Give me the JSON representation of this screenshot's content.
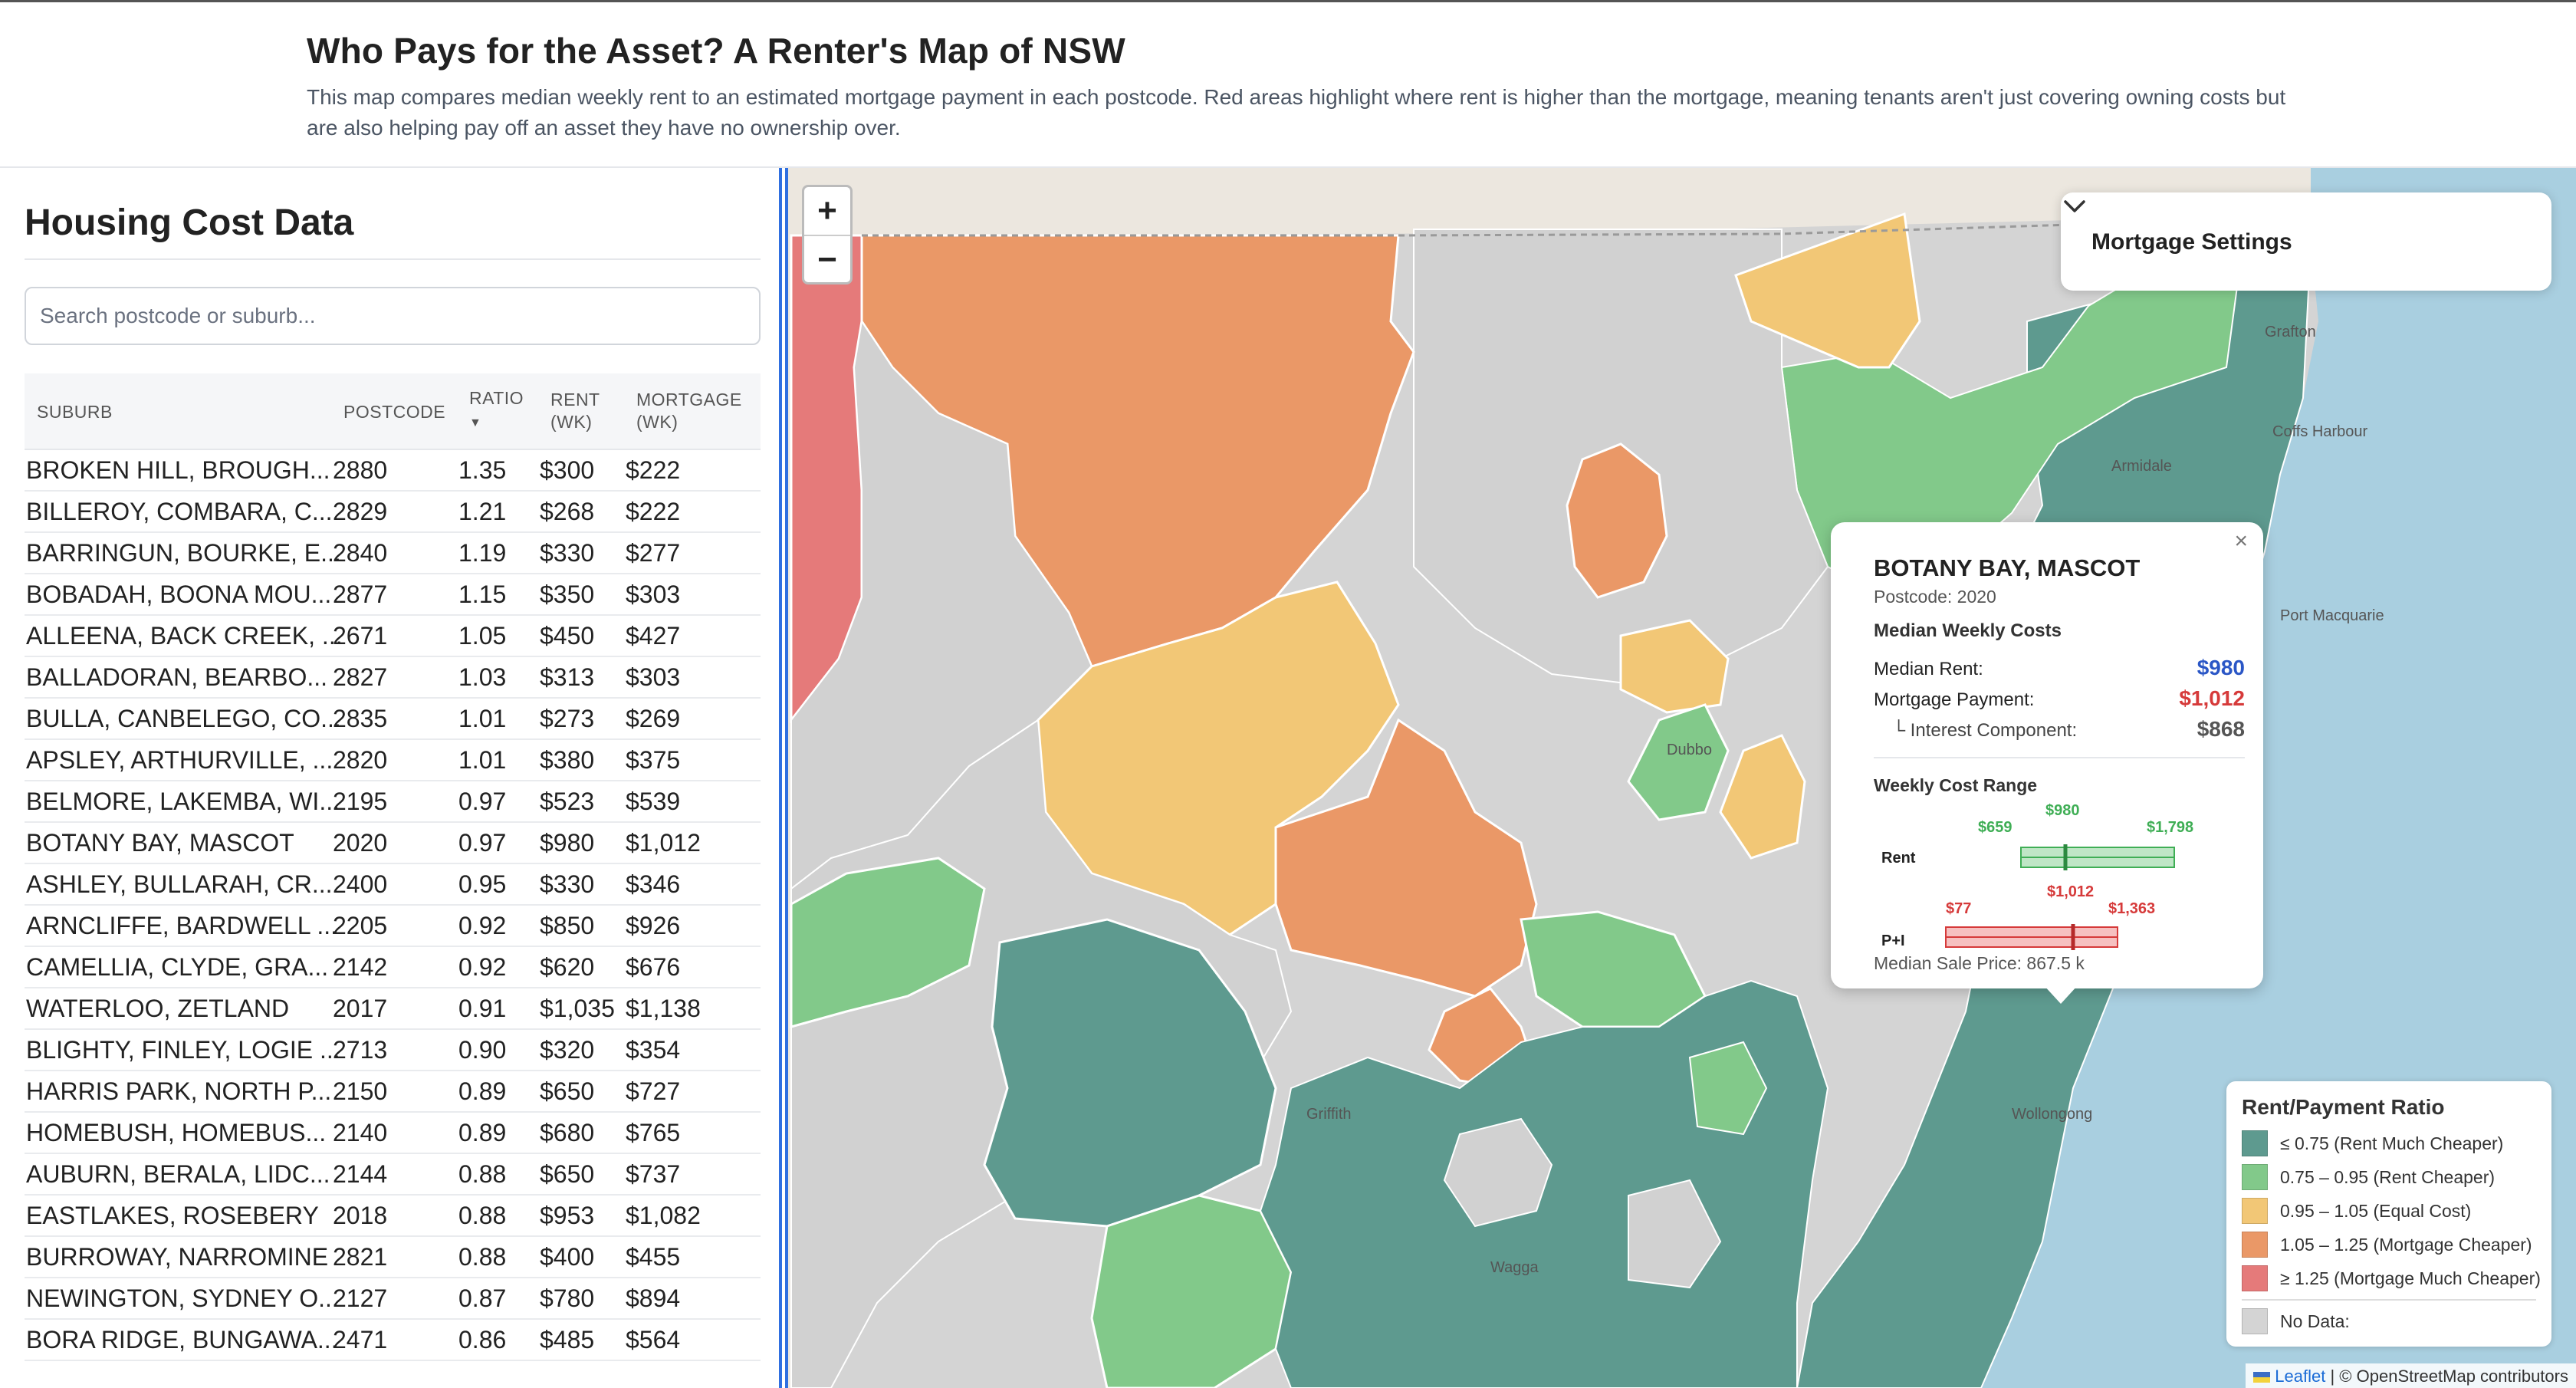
{
  "page": {
    "title": "Who Pays for the Asset? A Renter's Map of NSW",
    "description": "This map compares median weekly rent to an estimated mortgage payment in each postcode. Red areas highlight where rent is higher than the mortgage, meaning tenants aren't just covering owning costs but are also helping pay off an asset they have no ownership over."
  },
  "sidebar": {
    "title": "Housing Cost Data",
    "search_placeholder": "Search postcode or suburb...",
    "columns": {
      "suburb": "SUBURB",
      "postcode": "POSTCODE",
      "ratio_1": "RATIO",
      "ratio_2": "▼",
      "rent_1": "RENT",
      "rent_2": "(WK)",
      "mortgage_1": "MORTGAGE",
      "mortgage_2": "(WK)"
    },
    "rows": [
      {
        "suburb": "BROKEN HILL, BROUGH...",
        "postcode": "2880",
        "ratio": "1.35",
        "rent": "$300",
        "mortgage": "$222"
      },
      {
        "suburb": "BILLEROY, COMBARA, C...",
        "postcode": "2829",
        "ratio": "1.21",
        "rent": "$268",
        "mortgage": "$222"
      },
      {
        "suburb": "BARRINGUN, BOURKE, E...",
        "postcode": "2840",
        "ratio": "1.19",
        "rent": "$330",
        "mortgage": "$277"
      },
      {
        "suburb": "BOBADAH, BOONA MOU...",
        "postcode": "2877",
        "ratio": "1.15",
        "rent": "$350",
        "mortgage": "$303"
      },
      {
        "suburb": "ALLEENA, BACK CREEK, ...",
        "postcode": "2671",
        "ratio": "1.05",
        "rent": "$450",
        "mortgage": "$427"
      },
      {
        "suburb": "BALLADORAN, BEARBO...",
        "postcode": "2827",
        "ratio": "1.03",
        "rent": "$313",
        "mortgage": "$303"
      },
      {
        "suburb": "BULLA, CANBELEGO, CO...",
        "postcode": "2835",
        "ratio": "1.01",
        "rent": "$273",
        "mortgage": "$269"
      },
      {
        "suburb": "APSLEY, ARTHURVILLE, ...",
        "postcode": "2820",
        "ratio": "1.01",
        "rent": "$380",
        "mortgage": "$375"
      },
      {
        "suburb": "BELMORE, LAKEMBA, WI...",
        "postcode": "2195",
        "ratio": "0.97",
        "rent": "$523",
        "mortgage": "$539"
      },
      {
        "suburb": "BOTANY BAY, MASCOT",
        "postcode": "2020",
        "ratio": "0.97",
        "rent": "$980",
        "mortgage": "$1,012"
      },
      {
        "suburb": "ASHLEY, BULLARAH, CR...",
        "postcode": "2400",
        "ratio": "0.95",
        "rent": "$330",
        "mortgage": "$346"
      },
      {
        "suburb": "ARNCLIFFE, BARDWELL ...",
        "postcode": "2205",
        "ratio": "0.92",
        "rent": "$850",
        "mortgage": "$926"
      },
      {
        "suburb": "CAMELLIA, CLYDE, GRA...",
        "postcode": "2142",
        "ratio": "0.92",
        "rent": "$620",
        "mortgage": "$676"
      },
      {
        "suburb": "WATERLOO, ZETLAND",
        "postcode": "2017",
        "ratio": "0.91",
        "rent": "$1,035",
        "mortgage": "$1,138"
      },
      {
        "suburb": "BLIGHTY, FINLEY, LOGIE ...",
        "postcode": "2713",
        "ratio": "0.90",
        "rent": "$320",
        "mortgage": "$354"
      },
      {
        "suburb": "HARRIS PARK, NORTH P...",
        "postcode": "2150",
        "ratio": "0.89",
        "rent": "$650",
        "mortgage": "$727"
      },
      {
        "suburb": "HOMEBUSH, HOMEBUS...",
        "postcode": "2140",
        "ratio": "0.89",
        "rent": "$680",
        "mortgage": "$765"
      },
      {
        "suburb": "AUBURN, BERALA, LIDC...",
        "postcode": "2144",
        "ratio": "0.88",
        "rent": "$650",
        "mortgage": "$737"
      },
      {
        "suburb": "EASTLAKES, ROSEBERY",
        "postcode": "2018",
        "ratio": "0.88",
        "rent": "$953",
        "mortgage": "$1,082"
      },
      {
        "suburb": "BURROWAY, NARROMINE",
        "postcode": "2821",
        "ratio": "0.88",
        "rent": "$400",
        "mortgage": "$455"
      },
      {
        "suburb": "NEWINGTON, SYDNEY O...",
        "postcode": "2127",
        "ratio": "0.87",
        "rent": "$780",
        "mortgage": "$894"
      },
      {
        "suburb": "BORA RIDGE, BUNGAWA...",
        "postcode": "2471",
        "ratio": "0.86",
        "rent": "$485",
        "mortgage": "$564"
      }
    ]
  },
  "map": {
    "zoom_in": "+",
    "zoom_out": "−",
    "settings_label": "Mortgage Settings",
    "town_labels": [
      "Grafton",
      "Coffs Harbour",
      "Armidale",
      "Port Macquarie",
      "Dubbo",
      "Griffith",
      "Wagga",
      "Wollongong"
    ],
    "attribution_link": "Leaflet",
    "attribution_text": " | © OpenStreetMap contributors"
  },
  "popup": {
    "title": "BOTANY BAY, MASCOT",
    "postcode": "Postcode: 2020",
    "section1": "Median Weekly Costs",
    "rent_label": "Median Rent:",
    "rent_value": "$980",
    "mortgage_label": "Mortgage Payment:",
    "mortgage_value": "$1,012",
    "interest_label": "└ Interest Component:",
    "interest_value": "$868",
    "section2": "Weekly Cost Range",
    "rent_row": "Rent",
    "rent_min": "$659",
    "rent_mid": "$980",
    "rent_max": "$1,798",
    "pi_row": "P+I",
    "pi_min": "$77",
    "pi_mid": "$1,012",
    "pi_max": "$1,363",
    "sale_price": "Median Sale Price: 867.5 k",
    "close": "×"
  },
  "legend": {
    "title": "Rent/Payment Ratio",
    "items": [
      {
        "label": "≤ 0.75 (Rent Much Cheaper)",
        "color": "#5e9a8f"
      },
      {
        "label": "0.75 – 0.95 (Rent Cheaper)",
        "color": "#82c98a"
      },
      {
        "label": "0.95 – 1.05 (Equal Cost)",
        "color": "#f2c776"
      },
      {
        "label": "1.05 – 1.25 (Mortgage Cheaper)",
        "color": "#ea9867"
      },
      {
        "label": "≥ 1.25 (Mortgage Much Cheaper)",
        "color": "#e57a7a"
      },
      {
        "label": "No Data:",
        "color": "#d4d4d4"
      }
    ]
  },
  "colors": {
    "accent_blue": "#2f6fe0",
    "rent_blue": "#2a56c6",
    "mortgage_red": "#d63a3a",
    "ocean": "#a9cfe0"
  }
}
